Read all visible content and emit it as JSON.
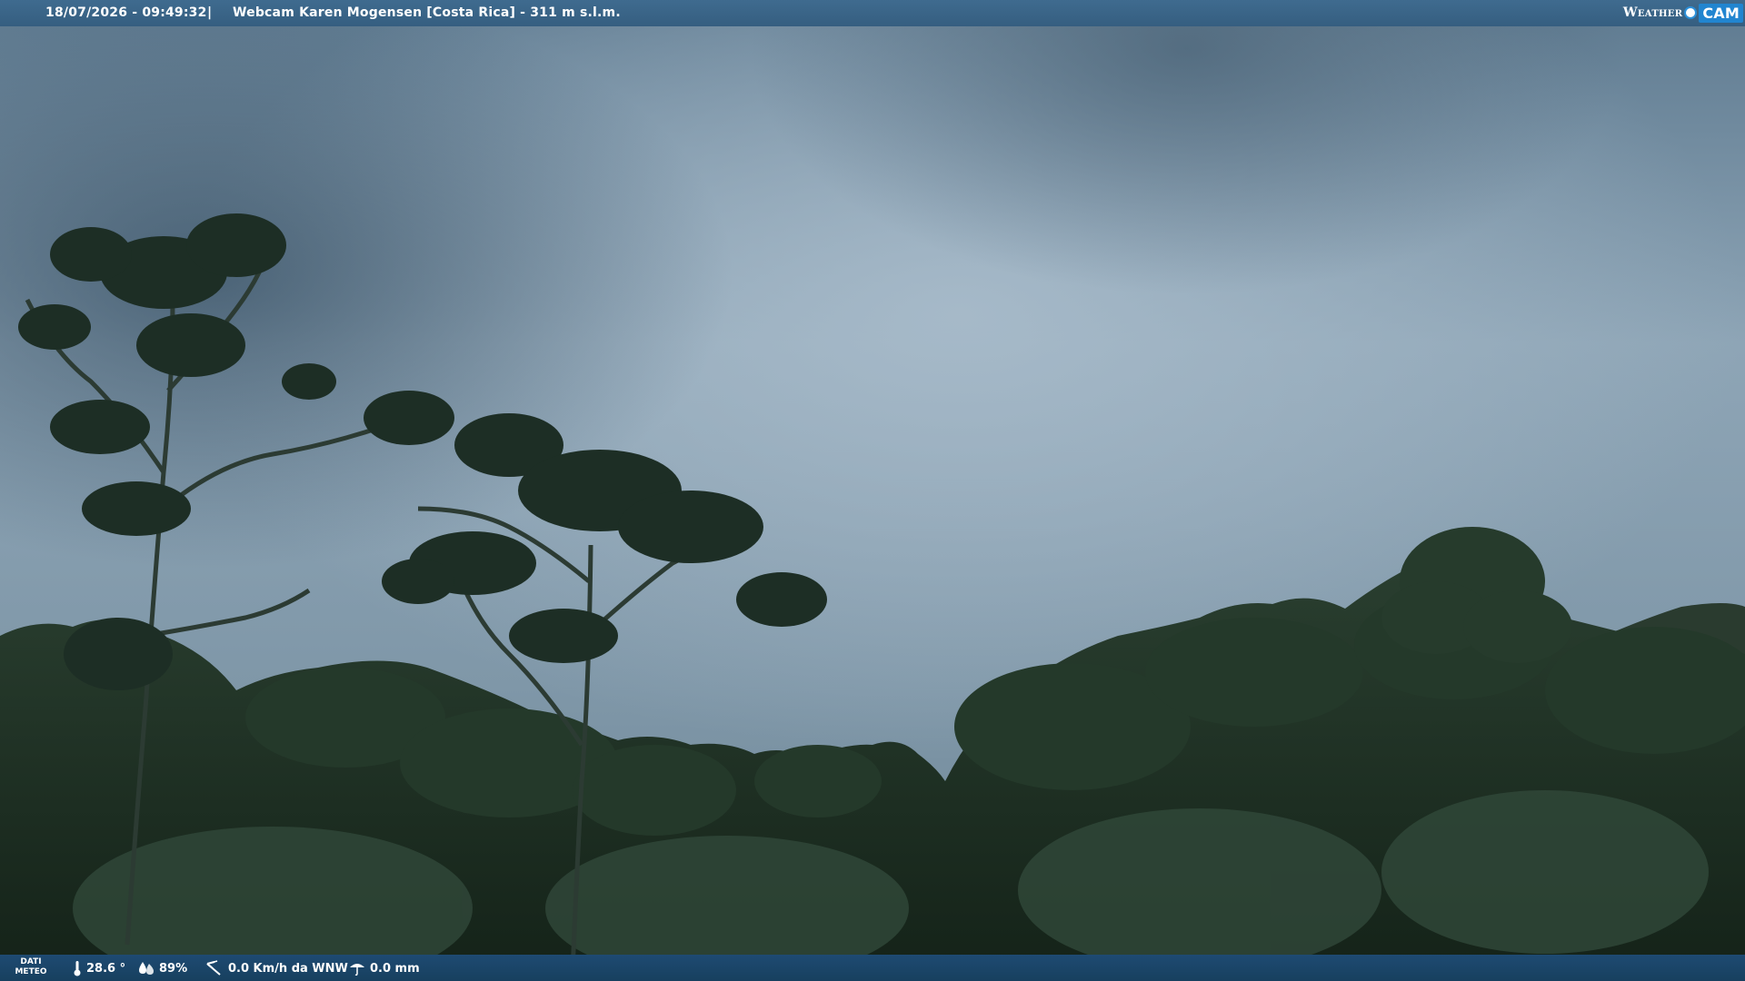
{
  "header": {
    "datetime": "18/07/2026 - 09:49:32",
    "separator": "|",
    "title": "Webcam Karen Mogensen [Costa Rica] - 311 m s.l.m."
  },
  "logo": {
    "weather_text": "Weather",
    "cam_text": "CAM"
  },
  "weather_bar": {
    "label_line1": "DATI",
    "label_line2": "METEO",
    "temperature": "28.6 °",
    "humidity": "89%",
    "wind": "0.0 Km/h da WNW",
    "rain": "0.0 mm"
  },
  "colors": {
    "topbar": "#3f6b8f",
    "bottombar": "#1e4a72",
    "logo_accent": "#2185d0",
    "sky": "#8fa6b6",
    "foliage": "#1f3324"
  },
  "icons": {
    "temperature": "thermometer-icon",
    "humidity": "humidity-icon",
    "wind": "wind-icon",
    "rain": "rain-icon"
  }
}
